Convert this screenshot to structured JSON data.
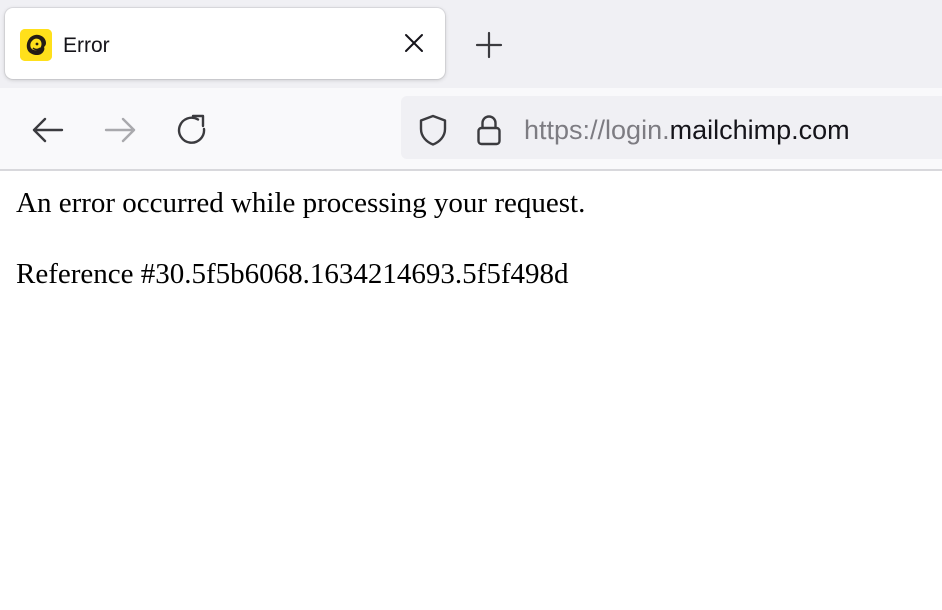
{
  "browser": {
    "tab": {
      "title": "Error",
      "favicon_icon": "mailchimp-freddie-icon",
      "favicon_color": "#ffe01b",
      "close_icon": "close-icon"
    },
    "new_tab_icon": "plus-icon",
    "nav": {
      "back_icon": "arrow-left-icon",
      "forward_icon": "arrow-right-icon",
      "forward_enabled": false,
      "reload_icon": "reload-icon"
    },
    "urlbar": {
      "shield_icon": "shield-icon",
      "lock_icon": "lock-icon",
      "url_prefix": "https://login.",
      "url_domain": "mailchimp.com"
    }
  },
  "page": {
    "message": "An error occurred while processing your request.",
    "reference": "Reference #30.5f5b6068.1634214693.5f5f498d"
  }
}
